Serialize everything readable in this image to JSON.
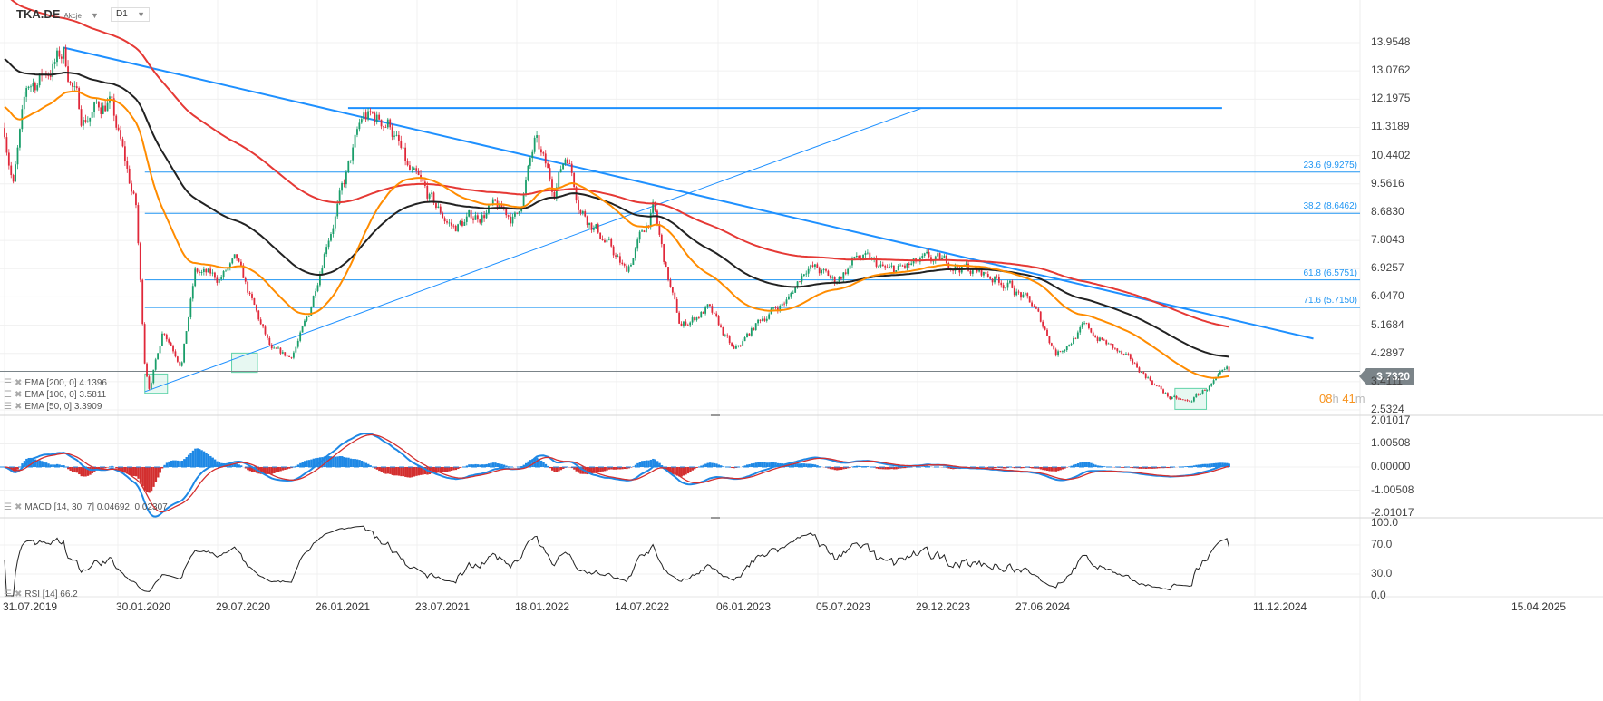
{
  "header": {
    "symbol": "TKA.DE",
    "type": "Akcje",
    "timeframe": "D1"
  },
  "countdown": {
    "hours": "08",
    "h": "h",
    "minutes": "41",
    "m": "m"
  },
  "chart_data": {
    "type": "candlestick",
    "title": "TKA.DE",
    "price_axis": {
      "range": [
        2.5324,
        13.9548
      ],
      "ticks": [
        "13.9548",
        "13.0762",
        "12.1975",
        "11.3189",
        "10.4402",
        "9.5616",
        "8.6830",
        "7.8043",
        "6.9257",
        "6.0470",
        "5.1684",
        "4.2897",
        "3.4111",
        "2.5324"
      ]
    },
    "current_price": "3.7320",
    "x_ticks": [
      "31.07.2019",
      "30.01.2020",
      "29.07.2020",
      "26.01.2021",
      "23.07.2021",
      "18.01.2022",
      "14.07.2022",
      "06.01.2023",
      "05.07.2023",
      "29.12.2023",
      "27.06.2024",
      "11.12.2024",
      "15.04.2025"
    ],
    "key_closes": [
      {
        "date": "2019-07-31",
        "close": 11.3
      },
      {
        "date": "2019-08-14",
        "close": 9.6
      },
      {
        "date": "2019-09-05",
        "close": 12.5
      },
      {
        "date": "2019-11-02",
        "close": 13.6
      },
      {
        "date": "2019-12-01",
        "close": 11.6
      },
      {
        "date": "2020-01-13",
        "close": 12.2
      },
      {
        "date": "2020-02-25",
        "close": 8.8
      },
      {
        "date": "2020-03-10",
        "close": 4.0
      },
      {
        "date": "2020-03-18",
        "close": 3.2
      },
      {
        "date": "2020-04-08",
        "close": 5.1
      },
      {
        "date": "2020-05-07",
        "close": 4.0
      },
      {
        "date": "2020-05-29",
        "close": 6.8
      },
      {
        "date": "2020-07-04",
        "close": 6.6
      },
      {
        "date": "2020-08-02",
        "close": 7.1
      },
      {
        "date": "2020-08-30",
        "close": 5.7
      },
      {
        "date": "2020-09-28",
        "close": 4.3
      },
      {
        "date": "2020-10-27",
        "close": 4.15
      },
      {
        "date": "2020-11-25",
        "close": 5.4
      },
      {
        "date": "2020-12-24",
        "close": 7.9
      },
      {
        "date": "2021-01-22",
        "close": 9.6
      },
      {
        "date": "2021-02-19",
        "close": 11.6
      },
      {
        "date": "2021-04-04",
        "close": 11.5
      },
      {
        "date": "2021-05-02",
        "close": 9.9
      },
      {
        "date": "2021-06-15",
        "close": 8.8
      },
      {
        "date": "2021-07-14",
        "close": 8.2
      },
      {
        "date": "2021-09-09",
        "close": 8.8
      },
      {
        "date": "2021-10-22",
        "close": 8.5
      },
      {
        "date": "2021-11-20",
        "close": 10.8
      },
      {
        "date": "2021-12-19",
        "close": 9.4
      },
      {
        "date": "2022-01-10",
        "close": 10.6
      },
      {
        "date": "2022-01-31",
        "close": 8.9
      },
      {
        "date": "2022-03-08",
        "close": 7.9
      },
      {
        "date": "2022-04-13",
        "close": 6.8
      },
      {
        "date": "2022-05-27",
        "close": 8.8
      },
      {
        "date": "2022-06-17",
        "close": 6.8
      },
      {
        "date": "2022-07-09",
        "close": 5.1
      },
      {
        "date": "2022-08-21",
        "close": 5.7
      },
      {
        "date": "2022-10-03",
        "close": 4.3
      },
      {
        "date": "2022-11-16",
        "close": 5.4
      },
      {
        "date": "2022-12-29",
        "close": 6.0
      },
      {
        "date": "2023-01-27",
        "close": 7.1
      },
      {
        "date": "2023-03-11",
        "close": 6.5
      },
      {
        "date": "2023-04-16",
        "close": 7.3
      },
      {
        "date": "2023-06-05",
        "close": 6.8
      },
      {
        "date": "2023-08-02",
        "close": 7.1
      },
      {
        "date": "2023-09-14",
        "close": 7.1
      },
      {
        "date": "2023-10-28",
        "close": 6.8
      },
      {
        "date": "2023-12-10",
        "close": 6.5
      },
      {
        "date": "2024-01-22",
        "close": 5.7
      },
      {
        "date": "2024-02-27",
        "close": 4.3
      },
      {
        "date": "2024-04-10",
        "close": 5.1
      },
      {
        "date": "2024-05-16",
        "close": 4.6
      },
      {
        "date": "2024-07-13",
        "close": 3.7
      },
      {
        "date": "2024-08-25",
        "close": 2.9
      },
      {
        "date": "2024-09-23",
        "close": 2.75
      },
      {
        "date": "2024-10-22",
        "close": 3.2
      },
      {
        "date": "2024-11-27",
        "close": 3.732
      }
    ],
    "indicators": {
      "ema": [
        {
          "label": "EMA [200, 0] 4.1396",
          "period": 200,
          "value": 4.1396,
          "color": "#e53935"
        },
        {
          "label": "EMA [100, 0] 3.5811",
          "period": 100,
          "value": 3.5811,
          "color": "#222222"
        },
        {
          "label": "EMA [50, 0] 3.3909",
          "period": 50,
          "value": 3.3909,
          "color": "#ff8c00"
        }
      ],
      "macd": {
        "label": "MACD [14, 30, 7] 0.04692, 0.02307",
        "fast": 14,
        "slow": 30,
        "signal": 7,
        "axis_ticks": [
          "2.01017",
          "1.00508",
          "0.00000",
          "-1.00508",
          "-2.01017"
        ],
        "colors": {
          "macd": "#1e88e5",
          "signal": "#d32f2f"
        }
      },
      "rsi": {
        "label": "RSI [14] 66.2",
        "period": 14,
        "value": 66.2,
        "axis_ticks": [
          "100.0",
          "70.0",
          "30.0",
          "0.0"
        ]
      }
    },
    "fibonacci": [
      {
        "label": "23.6 (9.9275)",
        "price": 9.9275
      },
      {
        "label": "38.2 (8.6462)",
        "price": 8.6462
      },
      {
        "label": "61.8 (6.5751)",
        "price": 6.5751
      },
      {
        "label": "71.6 (5.7150)",
        "price": 5.715
      }
    ],
    "fib_start_date": "2020-03-10",
    "trendlines": [
      {
        "from": {
          "date": "2019-11-02",
          "price": 13.8
        },
        "to": {
          "date": "2025-04-10",
          "price": 4.75
        },
        "width": 2
      },
      {
        "from": {
          "date": "2020-03-10",
          "price": 3.1
        },
        "to": {
          "date": "2023-07-28",
          "price": 11.92
        },
        "width": 1
      }
    ],
    "horizontal_lines": [
      {
        "price": 11.92,
        "from": "2021-01-27",
        "to": "2024-11-16"
      }
    ],
    "boxes": [
      {
        "from": "2020-03-10",
        "to": "2020-04-15",
        "low": 3.05,
        "high": 3.65
      },
      {
        "from": "2020-07-26",
        "to": "2020-09-05",
        "low": 3.7,
        "high": 4.3
      },
      {
        "from": "2024-09-02",
        "to": "2024-10-22",
        "low": 2.55,
        "high": 3.2
      }
    ],
    "colors": {
      "up": "#1a9e6a",
      "down": "#e0283a",
      "trend": "#1e90ff",
      "grid": "#f0f0f0"
    }
  }
}
